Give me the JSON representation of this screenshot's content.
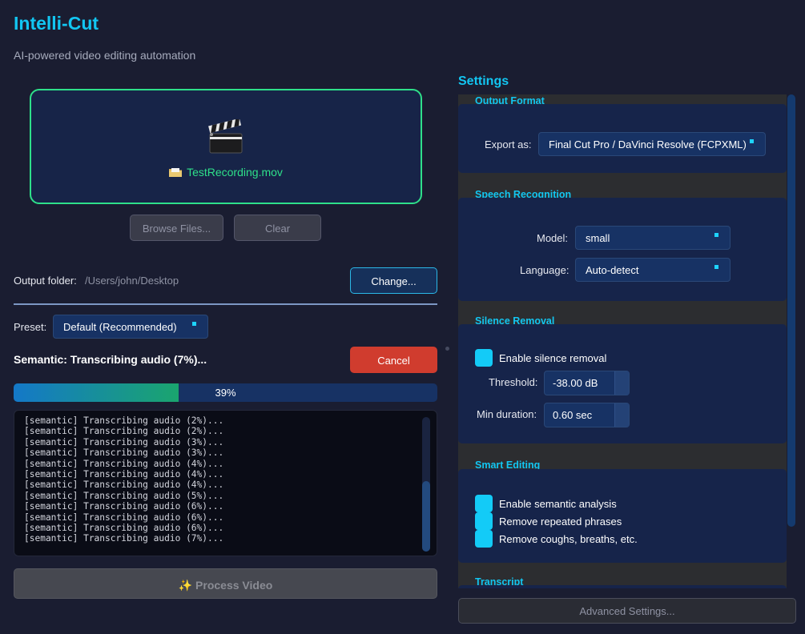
{
  "app": {
    "title": "Intelli-Cut",
    "subtitle": "AI-powered video editing automation"
  },
  "file": {
    "name": "TestRecording.mov",
    "browse_label": "Browse Files...",
    "clear_label": "Clear"
  },
  "output": {
    "label": "Output folder:",
    "path": "/Users/john/Desktop",
    "change_label": "Change..."
  },
  "preset": {
    "label": "Preset:",
    "value": "Default (Recommended)"
  },
  "status": {
    "text": "Semantic: Transcribing audio (7%)...",
    "cancel_label": "Cancel",
    "progress_percent": 39,
    "progress_label": "39%"
  },
  "log": {
    "lines": [
      "[semantic] Transcribing audio (2%)...",
      "[semantic] Transcribing audio (2%)...",
      "[semantic] Transcribing audio (3%)...",
      "[semantic] Transcribing audio (3%)...",
      "[semantic] Transcribing audio (4%)...",
      "[semantic] Transcribing audio (4%)...",
      "[semantic] Transcribing audio (4%)...",
      "[semantic] Transcribing audio (5%)...",
      "[semantic] Transcribing audio (6%)...",
      "[semantic] Transcribing audio (6%)...",
      "[semantic] Transcribing audio (6%)...",
      "[semantic] Transcribing audio (7%)..."
    ]
  },
  "process": {
    "label": "✨ Process Video"
  },
  "settings": {
    "title": "Settings",
    "output_format": {
      "title": "Output Format",
      "export_label": "Export as:",
      "export_value": "Final Cut Pro / DaVinci Resolve (FCPXML)"
    },
    "speech": {
      "title": "Speech Recognition",
      "model_label": "Model:",
      "model_value": "small",
      "language_label": "Language:",
      "language_value": "Auto-detect"
    },
    "silence": {
      "title": "Silence Removal",
      "enable_label": "Enable silence removal",
      "threshold_label": "Threshold:",
      "threshold_value": "-38.00 dB",
      "min_duration_label": "Min duration:",
      "min_duration_value": "0.60 sec"
    },
    "smart": {
      "title": "Smart Editing",
      "semantic_label": "Enable semantic analysis",
      "repeated_label": "Remove repeated phrases",
      "coughs_label": "Remove coughs, breaths, etc."
    },
    "transcript": {
      "title": "Transcript"
    },
    "advanced_label": "Advanced Settings..."
  },
  "colors": {
    "accent": "#12c6f2",
    "success": "#2ee08a",
    "danger": "#d03c2e",
    "background": "#1a1d31"
  }
}
